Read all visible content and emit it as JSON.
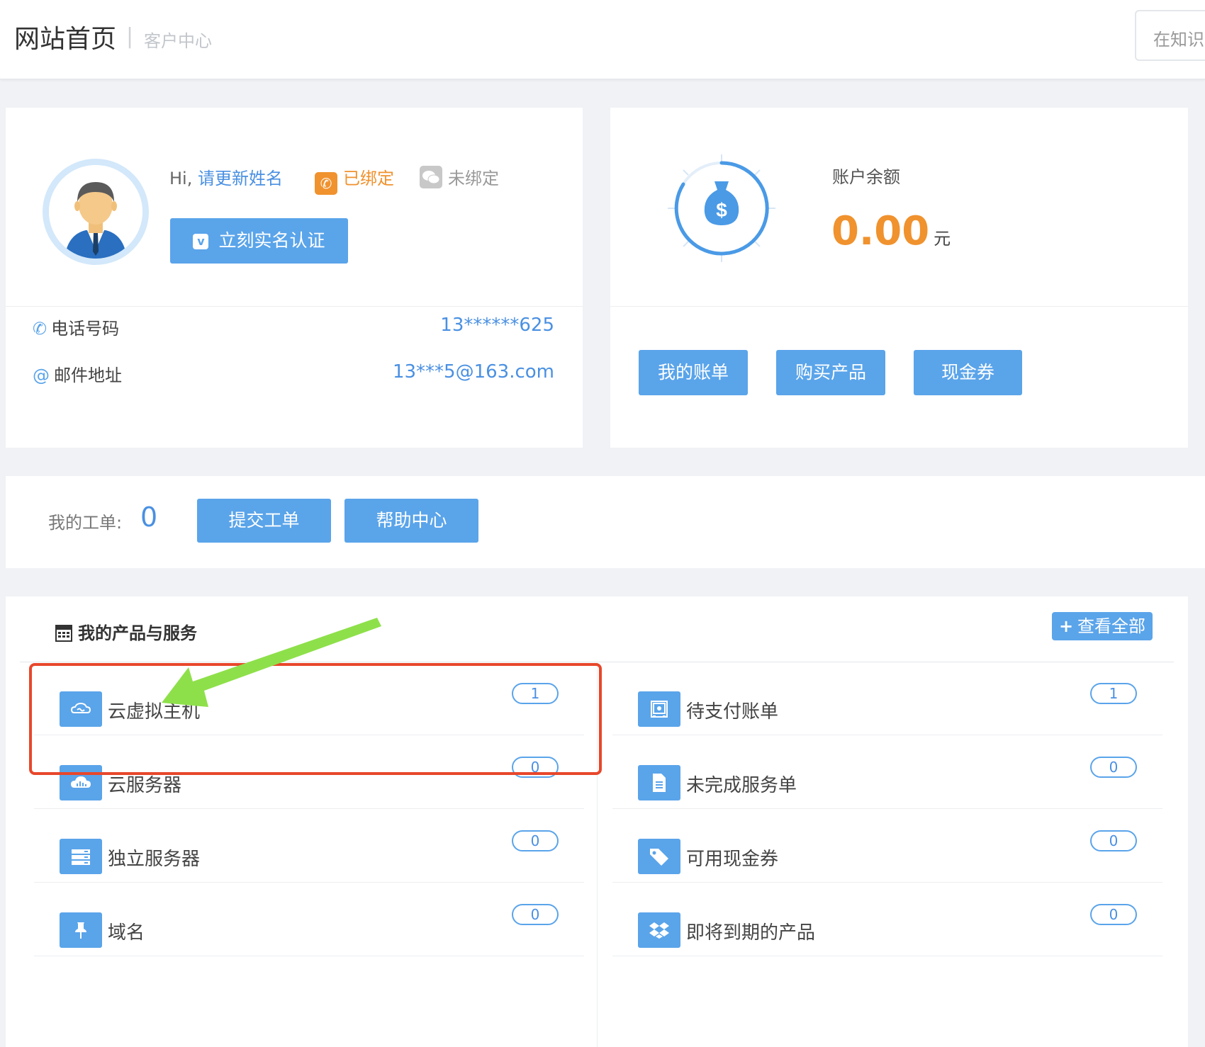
{
  "header": {
    "site_title": "网站首页",
    "separator": "|",
    "sub_title": "客户中心",
    "search_placeholder": "在知识"
  },
  "profile": {
    "greeting_prefix": "Hi,",
    "name": "请更新姓名",
    "phone_bind_status": "已绑定",
    "wechat_bind_status": "未绑定",
    "verify_button": "立刻实名认证",
    "phone_label": "电话号码",
    "phone_value": "13******625",
    "email_icon": "@",
    "email_label": "邮件地址",
    "email_value": "13***5@163.com"
  },
  "balance": {
    "label": "账户余额",
    "value": "0.00",
    "unit": "元",
    "buttons": [
      "我的账单",
      "购买产品",
      "现金券"
    ]
  },
  "tickets": {
    "label": "我的工单:",
    "count": "0",
    "submit_button": "提交工单",
    "help_button": "帮助中心"
  },
  "products": {
    "title": "我的产品与服务",
    "view_all": "查看全部",
    "left": [
      {
        "label": "云虚拟主机",
        "count": "1",
        "icon": "cloud-link-icon"
      },
      {
        "label": "云服务器",
        "count": "0",
        "icon": "cloud-chart-icon"
      },
      {
        "label": "独立服务器",
        "count": "0",
        "icon": "server-icon"
      },
      {
        "label": "域名",
        "count": "0",
        "icon": "pin-icon"
      }
    ],
    "right": [
      {
        "label": "待支付账单",
        "count": "1",
        "icon": "safe-icon"
      },
      {
        "label": "未完成服务单",
        "count": "0",
        "icon": "document-icon"
      },
      {
        "label": "可用现金券",
        "count": "0",
        "icon": "tag-icon"
      },
      {
        "label": "即将到期的产品",
        "count": "0",
        "icon": "dropbox-icon"
      }
    ]
  },
  "colors": {
    "accent": "#5aa4ea",
    "link": "#4a90e2",
    "orange": "#f0922e",
    "highlight_border": "#e8472b",
    "arrow": "#8ee04a"
  }
}
